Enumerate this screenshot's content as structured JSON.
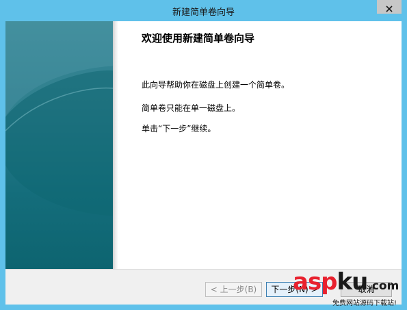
{
  "window": {
    "title": "新建简单卷向导"
  },
  "wizard": {
    "heading": "欢迎使用新建简单卷向导",
    "paragraphs": [
      "此向导帮助你在磁盘上创建一个简单卷。",
      "简单卷只能在单一磁盘上。",
      "单击“下一步”继续。"
    ]
  },
  "buttons": {
    "back": "< 上一步(B)",
    "next": "下一步(N) >",
    "cancel": "取消"
  },
  "watermark": {
    "logo_red": "asp",
    "logo_dark": "ku",
    "logo_small": ".com",
    "subtitle": "免费网站源码下载站!"
  },
  "colors": {
    "titlebar": "#5fc1ea",
    "side_panel": "#146d7b",
    "watermark_red": "#e8212e"
  },
  "icons": {
    "close": "close-icon"
  }
}
